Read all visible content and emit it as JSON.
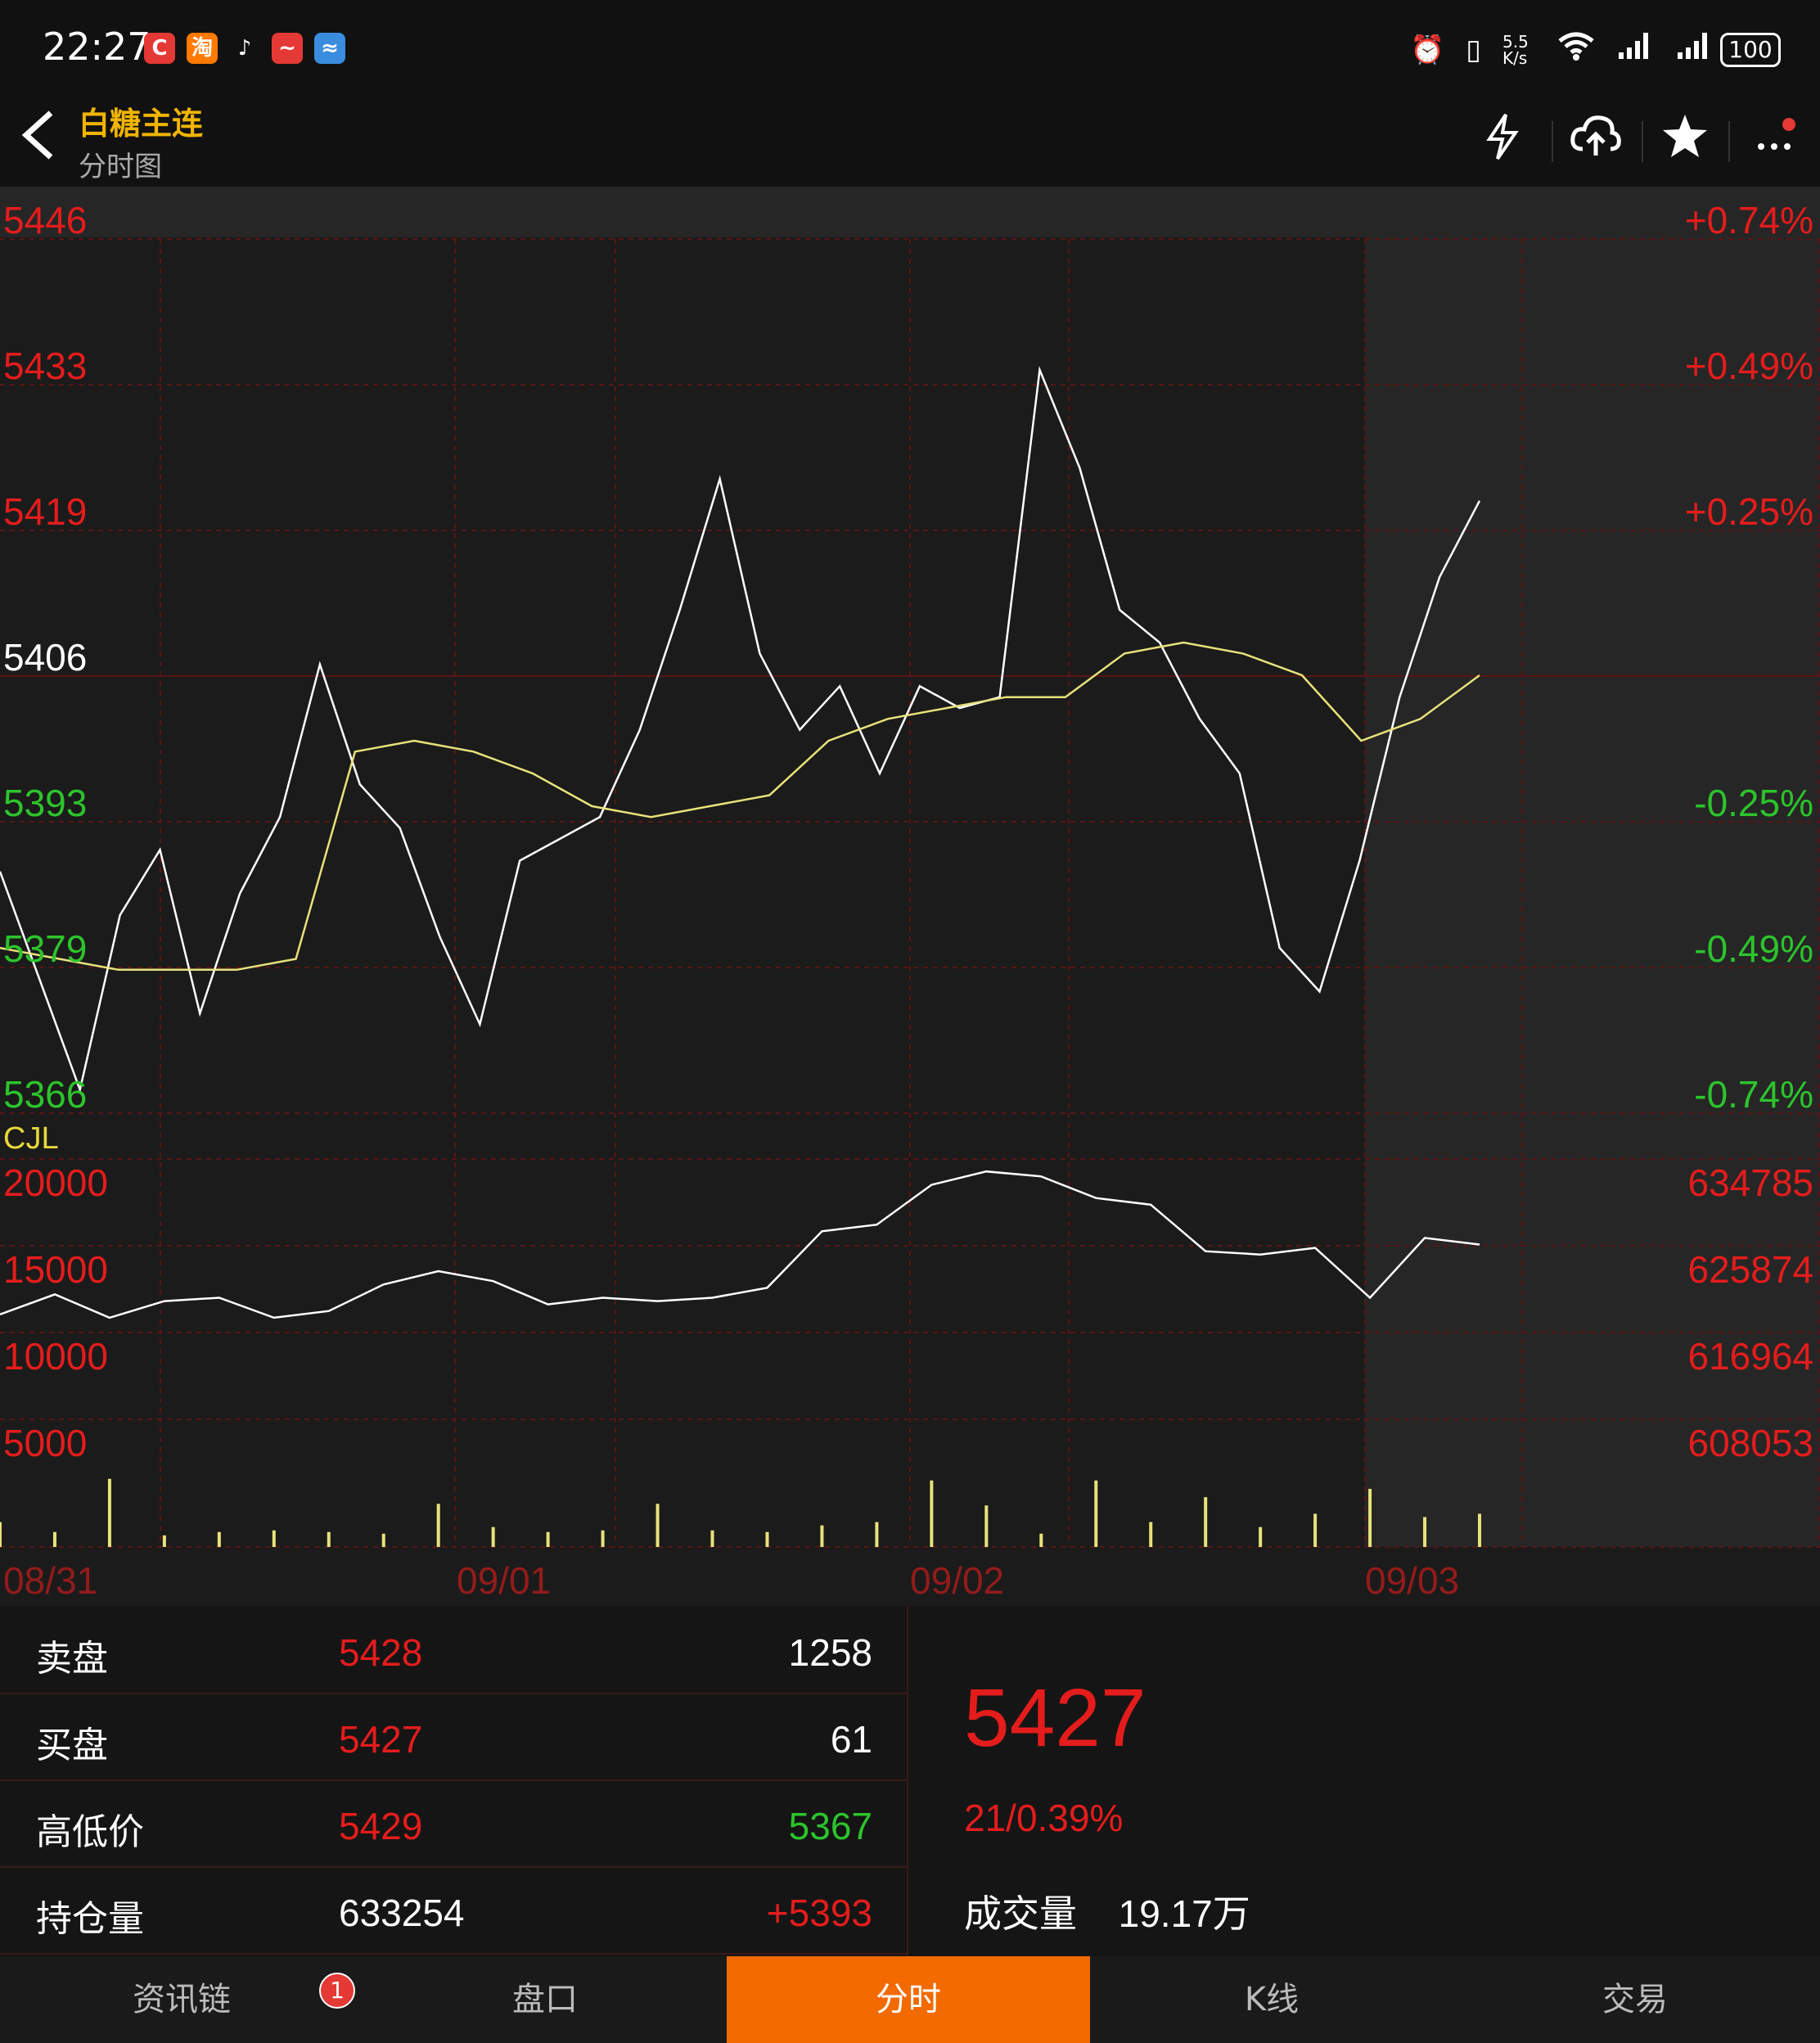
{
  "status": {
    "time": "22:27",
    "net_speed": "5.5 K/s",
    "battery": "100",
    "apps": [
      {
        "label": "C",
        "color": "#e53935"
      },
      {
        "label": "淘",
        "color": "#ff7a00"
      },
      {
        "label": "♪",
        "color": "#111111"
      },
      {
        "label": "~",
        "color": "#e53935"
      },
      {
        "label": "≈",
        "color": "#3a8dde"
      }
    ]
  },
  "header": {
    "title": "白糖主连",
    "subtitle": "分时图"
  },
  "price_axis": {
    "left": [
      "5446",
      "5433",
      "5419",
      "5406",
      "5393",
      "5379",
      "5366"
    ],
    "right": [
      "+0.74%",
      "+0.49%",
      "+0.25%",
      "",
      "-0.25%",
      "-0.49%",
      "-0.74%"
    ]
  },
  "volume_axis": {
    "label": "CJL",
    "left": [
      "20000",
      "15000",
      "10000",
      "5000"
    ],
    "right": [
      "634785",
      "625874",
      "616964",
      "608053"
    ]
  },
  "dates": [
    "08/31",
    "09/01",
    "09/02",
    "09/03"
  ],
  "chart_data": {
    "type": "line",
    "x": [
      "08/31",
      "09/01",
      "09/02",
      "09/03"
    ],
    "ylim": [
      5366,
      5446
    ],
    "reference_price": 5406,
    "series": [
      {
        "values": [
          5388,
          5378,
          5368,
          5384,
          5390,
          5375,
          5386,
          5393,
          5407,
          5396,
          5392,
          5382,
          5374,
          5389,
          5391,
          5393,
          5401,
          5412,
          5424,
          5408,
          5401,
          5405,
          5397,
          5405,
          5403,
          5404,
          5434,
          5425,
          5412,
          5409,
          5402,
          5397,
          5381,
          5377,
          5389,
          5404,
          5415,
          5422
        ]
      },
      {
        "values": [
          5381,
          5380,
          5379,
          5379,
          5379,
          5380,
          5399,
          5400,
          5399,
          5397,
          5394,
          5393,
          5394,
          5395,
          5400,
          5402,
          5403,
          5404,
          5404,
          5408,
          5409,
          5408,
          5406,
          5400,
          5402,
          5406
        ]
      },
      {
        "values": [
          14000,
          15200,
          13800,
          14800,
          15000,
          13800,
          14200,
          15800,
          16600,
          16000,
          14600,
          15000,
          14800,
          15000,
          15600,
          19000,
          19400,
          21800,
          22600,
          22300,
          21000,
          20600,
          17800,
          17600,
          18000,
          15000,
          18600,
          18200
        ]
      },
      {
        "values": [
          1500,
          900,
          4100,
          700,
          900,
          1000,
          900,
          800,
          2600,
          1200,
          900,
          1000,
          2600,
          1000,
          900,
          1300,
          1500,
          4000,
          2500,
          800,
          4000,
          1500,
          3000,
          1200,
          2000,
          3500,
          1800,
          2000
        ]
      }
    ]
  },
  "orderbook": {
    "rows": [
      {
        "label": "卖盘",
        "mid": "5428",
        "right": "1258",
        "mid_color": "red",
        "right_color": "white"
      },
      {
        "label": "买盘",
        "mid": "5427",
        "right": "61",
        "mid_color": "red",
        "right_color": "white"
      },
      {
        "label": "高低价",
        "mid": "5429",
        "right": "5367",
        "mid_color": "red",
        "right_color": "green"
      },
      {
        "label": "持仓量",
        "mid": "633254",
        "right": "+5393",
        "mid_color": "white",
        "right_color": "red"
      }
    ],
    "last_price": "5427",
    "change": "21/0.39%",
    "volume_label": "成交量",
    "volume_value": "19.17万"
  },
  "tabs": [
    {
      "label": "资讯链",
      "badge": "1"
    },
    {
      "label": "盘口"
    },
    {
      "label": "分时",
      "active": true
    },
    {
      "label": "K线"
    },
    {
      "label": "交易"
    }
  ]
}
